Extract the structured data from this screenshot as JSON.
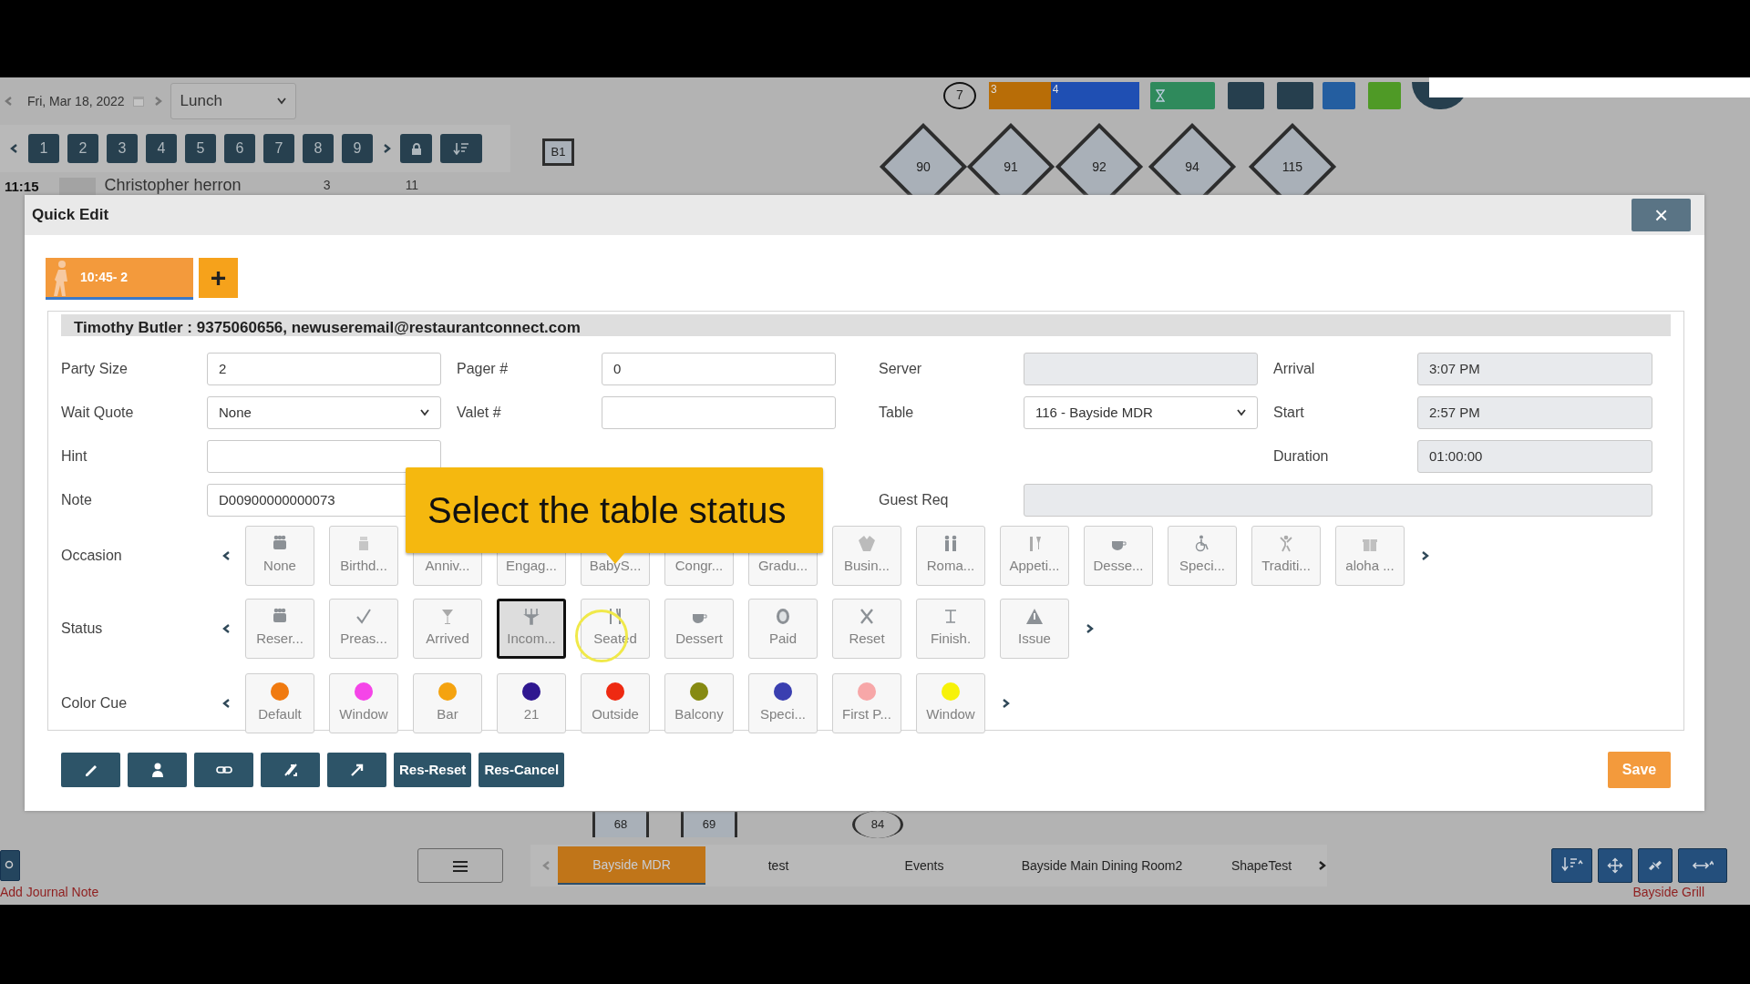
{
  "toolbar": {
    "date": "Fri, Mar 18, 2022",
    "meal_period": "Lunch",
    "pages": [
      "1",
      "2",
      "3",
      "4",
      "5",
      "6",
      "7",
      "8",
      "9"
    ],
    "counter": "7",
    "bar": {
      "level": 0.41,
      "segments": [
        {
          "label": "3",
          "color": "#b86d07"
        },
        {
          "label": "4",
          "color": "#1f4fb3"
        }
      ]
    }
  },
  "reservation_row": {
    "time": "11:15",
    "name": "Christopher herron",
    "party": "3",
    "table": "11"
  },
  "floor_tables": [
    {
      "label": "B1",
      "kind": "square"
    },
    {
      "label": "90",
      "kind": "diamond"
    },
    {
      "label": "91",
      "kind": "diamond"
    },
    {
      "label": "92",
      "kind": "diamond"
    },
    {
      "label": "94",
      "kind": "diamond"
    },
    {
      "label": "115",
      "kind": "diamond"
    },
    {
      "label": "68",
      "kind": "square"
    },
    {
      "label": "69",
      "kind": "square"
    },
    {
      "label": "84",
      "kind": "round"
    }
  ],
  "modal": {
    "title": "Quick Edit",
    "close": "×",
    "tabs": [
      {
        "label": "10:45- 2",
        "selected": true
      }
    ],
    "add_tab": "+",
    "guest": "Timothy Butler : 9375060656, newuseremail@restaurantconnect.com",
    "fields": [
      {
        "label": "Party Size",
        "value": "2",
        "kind": "text"
      },
      {
        "label": "Pager #",
        "value": "0",
        "kind": "text"
      },
      {
        "label": "Server",
        "kind": "readonly"
      },
      {
        "label": "Arrival",
        "value": "3:07 PM",
        "kind": "readonly"
      },
      {
        "label": "Wait Quote",
        "value": "None",
        "kind": "select"
      },
      {
        "label": "Valet #",
        "kind": "text"
      },
      {
        "label": "Table",
        "value": "116 - Bayside MDR",
        "kind": "select"
      },
      {
        "label": "Start",
        "value": "2:57 PM",
        "kind": "readonly"
      },
      {
        "label": "Hint",
        "kind": "text"
      },
      {
        "label": "Duration",
        "value": "01:00:00",
        "kind": "readonly"
      },
      {
        "label": "Note",
        "value": "D00900000000073",
        "kind": "text"
      },
      {
        "label": "Guest Req",
        "kind": "wide"
      }
    ],
    "occasion_label": "Occasion",
    "occasions": [
      {
        "label": "None"
      },
      {
        "label": "Birthd..."
      },
      {
        "label": "Anniv..."
      },
      {
        "label": "Engag..."
      },
      {
        "label": "BabyS..."
      },
      {
        "label": "Congr..."
      },
      {
        "label": "Gradu..."
      },
      {
        "label": "Busin..."
      },
      {
        "label": "Roma..."
      },
      {
        "label": "Appeti..."
      },
      {
        "label": "Desse..."
      },
      {
        "label": "Speci..."
      },
      {
        "label": "Traditi..."
      },
      {
        "label": "aloha ..."
      }
    ],
    "status_label": "Status",
    "statuses": [
      {
        "label": "Reser...",
        "selected": false
      },
      {
        "label": "Preas...",
        "selected": false
      },
      {
        "label": "Arrived",
        "selected": false
      },
      {
        "label": "Incom...",
        "selected": true
      },
      {
        "label": "Seated",
        "selected": false
      },
      {
        "label": "Dessert",
        "selected": false
      },
      {
        "label": "Paid",
        "selected": false
      },
      {
        "label": "Reset",
        "selected": false
      },
      {
        "label": "Finish.",
        "selected": false
      },
      {
        "label": "Issue",
        "selected": false
      }
    ],
    "color_label": "Color Cue",
    "color_cues": [
      {
        "label": "Default",
        "color": "#f07a10"
      },
      {
        "label": "Window",
        "color": "#f545e8"
      },
      {
        "label": "Bar",
        "color": "#f5a30f"
      },
      {
        "label": "21",
        "color": "#2f1790"
      },
      {
        "label": "Outside",
        "color": "#ee2a12"
      },
      {
        "label": "Balcony",
        "color": "#868a12"
      },
      {
        "label": "Speci...",
        "color": "#3a3fb0"
      },
      {
        "label": "First P...",
        "color": "#f7a7a8"
      },
      {
        "label": "Window",
        "color": "#f7f209"
      }
    ],
    "actions": [
      "Res-Reset",
      "Res-Cancel"
    ],
    "save": "Save"
  },
  "tooltip": "Select the table status",
  "floor_tabs": [
    {
      "label": "Bayside MDR",
      "selected": true
    },
    {
      "label": "test",
      "selected": false
    },
    {
      "label": "Events",
      "selected": false
    },
    {
      "label": "Bayside Main Dining Room2",
      "selected": false
    },
    {
      "label": "ShapeTest",
      "selected": false
    }
  ],
  "journal_link": "Add Journal Note",
  "venue": "Bayside Grill"
}
